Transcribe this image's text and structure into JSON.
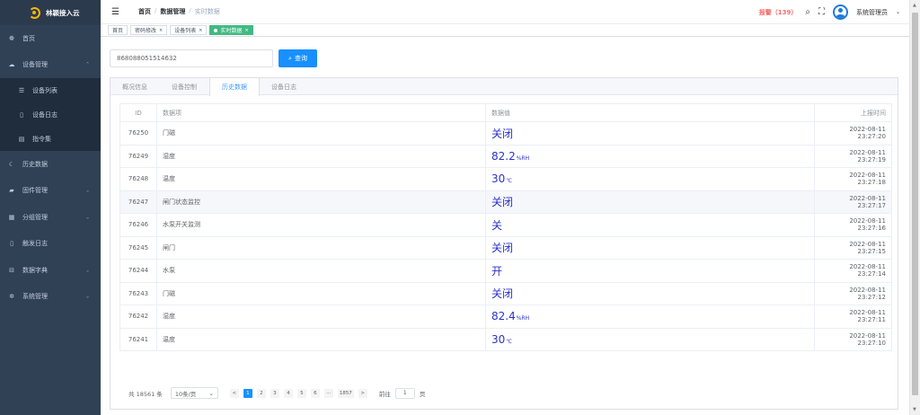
{
  "app": {
    "title": "林颖接入云"
  },
  "sidebar": {
    "items": [
      {
        "label": "首页",
        "icon": "dashboard-icon",
        "glyph": "❁"
      },
      {
        "label": "设备管理",
        "icon": "cloud-icon",
        "glyph": "☁",
        "chevron": "⌃"
      },
      {
        "label": "设备列表",
        "icon": "list-icon",
        "glyph": "☰"
      },
      {
        "label": "设备日志",
        "icon": "log-icon",
        "glyph": "▯"
      },
      {
        "label": "指令集",
        "icon": "command-icon",
        "glyph": "▤"
      },
      {
        "label": "历史数据",
        "icon": "history-icon",
        "glyph": "☾"
      },
      {
        "label": "固件管理",
        "icon": "firmware-icon",
        "glyph": "▰",
        "chevron": "⌄"
      },
      {
        "label": "分组管理",
        "icon": "group-icon",
        "glyph": "▦",
        "chevron": "⌄"
      },
      {
        "label": "触发日志",
        "icon": "trigger-log-icon",
        "glyph": "▯"
      },
      {
        "label": "数据字典",
        "icon": "dictionary-icon",
        "glyph": "⊟",
        "chevron": "⌄"
      },
      {
        "label": "系统管理",
        "icon": "settings-icon",
        "glyph": "✲",
        "chevron": "⌄"
      }
    ]
  },
  "header": {
    "breadcrumb": [
      "首页",
      "数据管理",
      "实时数据"
    ],
    "separator": "/",
    "alarm": "报警（139）",
    "username": "系统管理员",
    "hamburger_glyph": "☰",
    "search_glyph": "⌕",
    "fullscreen_glyph": "⛶",
    "caret_glyph": "⌄"
  },
  "tags": [
    {
      "label": "首页"
    },
    {
      "label": "密码修改",
      "close": "×"
    },
    {
      "label": "设备列表",
      "close": "×"
    },
    {
      "label": "实时数据",
      "close": "×"
    }
  ],
  "search": {
    "value": "868088051514632",
    "button_label": "查询",
    "button_glyph": "⌕"
  },
  "tabs": [
    "概况信息",
    "设备控制",
    "历史数据",
    "设备日志"
  ],
  "table": {
    "columns": [
      "ID",
      "数据项",
      "数据值",
      "上报时间"
    ],
    "rows": [
      {
        "id": "76250",
        "name": "门磁",
        "value": "关闭",
        "unit": "",
        "time": "2022-08-11 23:27:20"
      },
      {
        "id": "76249",
        "name": "湿度",
        "value": "82.2",
        "unit": "%RH",
        "time": "2022-08-11 23:27:19"
      },
      {
        "id": "76248",
        "name": "温度",
        "value": "30",
        "unit": "℃",
        "time": "2022-08-11 23:27:18"
      },
      {
        "id": "76247",
        "name": "闸门状态监控",
        "value": "关闭",
        "unit": "",
        "time": "2022-08-11 23:27:17"
      },
      {
        "id": "76246",
        "name": "水泵开关监测",
        "value": "关",
        "unit": "",
        "time": "2022-08-11 23:27:16"
      },
      {
        "id": "76245",
        "name": "闸门",
        "value": "关闭",
        "unit": "",
        "time": "2022-08-11 23:27:15"
      },
      {
        "id": "76244",
        "name": "水泵",
        "value": "开",
        "unit": "",
        "time": "2022-08-11 23:27:14"
      },
      {
        "id": "76243",
        "name": "门磁",
        "value": "关闭",
        "unit": "",
        "time": "2022-08-11 23:27:12"
      },
      {
        "id": "76242",
        "name": "湿度",
        "value": "82.4",
        "unit": "%RH",
        "time": "2022-08-11 23:27:11"
      },
      {
        "id": "76241",
        "name": "温度",
        "value": "30",
        "unit": "℃",
        "time": "2022-08-11 23:27:10"
      }
    ]
  },
  "pagination": {
    "total": "共 18561 条",
    "page_size": "10条/页",
    "page_size_caret": "⌄",
    "prev": "<",
    "next": ">",
    "pages": [
      "1",
      "2",
      "3",
      "4",
      "5",
      "6",
      "···",
      "1857"
    ],
    "goto_label": "前往",
    "goto_value": "1",
    "goto_suffix": "页"
  },
  "scrollbar": {
    "up": "▲",
    "down": "▼"
  },
  "colors": {
    "sidebar": "#304156",
    "primary": "#1890ff",
    "active_tag": "#42b983",
    "alarm": "#f56c6c",
    "value": "#2a33c9"
  }
}
